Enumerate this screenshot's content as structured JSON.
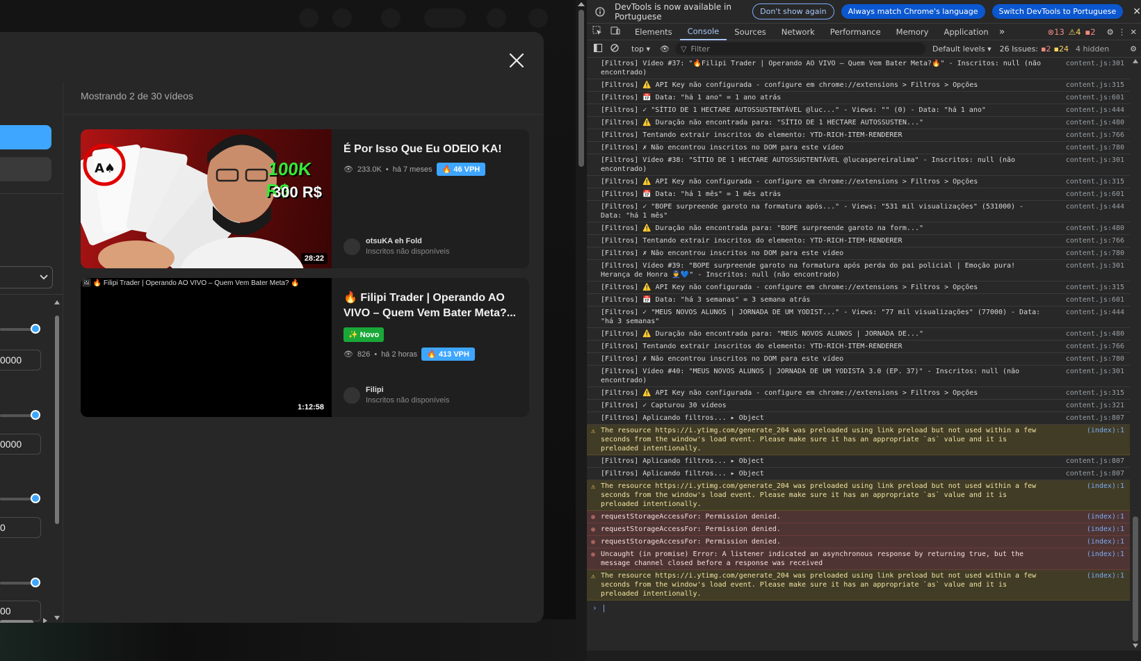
{
  "modal": {
    "showing": "Mostrando 2 de 30 vídeos",
    "inputs": [
      "0000",
      "0000",
      "0",
      "00"
    ],
    "videos": [
      {
        "title": "É Por Isso Que Eu ODEIO KA!",
        "views": "233.0K",
        "age": "há 7 meses",
        "vph": "46 VPH",
        "channel": "otsuKA eh Fold",
        "subs": "Inscritos não disponíveis",
        "duration": "28:22",
        "thumb_text_1": "100K R$",
        "thumb_text_2": "300 R$"
      },
      {
        "title": "🔥 Filipi Trader | Operando AO VIVO – Quem Vem Bater Meta?...",
        "thumb_alt": "🔥 Filipi Trader | Operando AO VIVO – Quem Vem Bater Meta? 🔥",
        "badge": "✨ Novo",
        "views": "826",
        "age": "há 2 horas",
        "vph": "413 VPH",
        "channel": "Filipi",
        "subs": "Inscritos não disponíveis",
        "duration": "1:12:58"
      }
    ]
  },
  "devtools": {
    "infobar": {
      "message": "DevTools is now available in Portuguese",
      "btn_dont_show": "Don't show again",
      "btn_always_match": "Always match Chrome's language",
      "btn_switch": "Switch DevTools to Portuguese"
    },
    "tabs": [
      "Elements",
      "Console",
      "Sources",
      "Network",
      "Performance",
      "Memory",
      "Application"
    ],
    "badges": {
      "errors": "13",
      "warnings": "4",
      "info": "2"
    },
    "toolbar": {
      "context": "top ▾",
      "filter_placeholder": "Filter",
      "levels": "Default levels ▾",
      "issues_label": "26 Issues:",
      "issues_err": "2",
      "issues_warn": "24",
      "hidden": "4 hidden"
    },
    "logs": [
      {
        "type": "log",
        "text": "[Filtros] Vídeo #37: \"🔥Filipi Trader | Operando AO VIVO – Quem Vem Bater Meta?🔥\" - Inscritos: null (não encontrado)",
        "src": "content.js:301"
      },
      {
        "type": "log",
        "text": "[Filtros] ⚠️ API Key não configurada - configure em chrome://extensions > Filtros > Opções",
        "src": "content.js:315"
      },
      {
        "type": "log",
        "text": "[Filtros] 📅 Data: \"há 1 ano\" = 1 ano atrás",
        "src": "content.js:601"
      },
      {
        "type": "log",
        "text": "[Filtros] ✓ \"SÍTIO DE 1 HECTARE AUTOSSUSTENTÁVEL @luc...\" - Views: \"\" (0) - Data: \"há 1 ano\"",
        "src": "content.js:444"
      },
      {
        "type": "log",
        "text": "[Filtros] ⚠️ Duração não encontrada para: \"SÍTIO DE 1 HECTARE AUTOSSUSTEN...\"",
        "src": "content.js:480"
      },
      {
        "type": "log",
        "text": "[Filtros] Tentando extrair inscritos do elemento: YTD-RICH-ITEM-RENDERER",
        "src": "content.js:766"
      },
      {
        "type": "log",
        "text": "[Filtros] ✗ Não encontrou inscritos no DOM para este vídeo",
        "src": "content.js:780"
      },
      {
        "type": "log",
        "text": "[Filtros] Vídeo #38: \"SÍTIO DE 1 HECTARE AUTOSSUSTENTÁVEL @lucaspereiralima\" - Inscritos: null (não encontrado)",
        "src": "content.js:301"
      },
      {
        "type": "log",
        "text": "[Filtros] ⚠️ API Key não configurada - configure em chrome://extensions > Filtros > Opções",
        "src": "content.js:315"
      },
      {
        "type": "log",
        "text": "[Filtros] 📅 Data: \"há 1 mês\" = 1 mês atrás",
        "src": "content.js:601"
      },
      {
        "type": "log",
        "text": "[Filtros] ✓ \"BOPE surpreende garoto na formatura após...\" - Views: \"531 mil visualizações\" (531000) - Data: \"há 1 mês\"",
        "src": "content.js:444"
      },
      {
        "type": "log",
        "text": "[Filtros] ⚠️ Duração não encontrada para: \"BOPE surpreende garoto na form...\"",
        "src": "content.js:480"
      },
      {
        "type": "log",
        "text": "[Filtros] Tentando extrair inscritos do elemento: YTD-RICH-ITEM-RENDERER",
        "src": "content.js:766"
      },
      {
        "type": "log",
        "text": "[Filtros] ✗ Não encontrou inscritos no DOM para este vídeo",
        "src": "content.js:780"
      },
      {
        "type": "log",
        "text": "[Filtros] Vídeo #39: \"BOPE surpreende garoto na formatura após perda do pai policial | Emoção pura! Herança de Honra 👮💙\" - Inscritos: null (não encontrado)",
        "src": "content.js:301"
      },
      {
        "type": "log",
        "text": "[Filtros] ⚠️ API Key não configurada - configure em chrome://extensions > Filtros > Opções",
        "src": "content.js:315"
      },
      {
        "type": "log",
        "text": "[Filtros] 📅 Data: \"há 3 semanas\" = 3 semana atrás",
        "src": "content.js:601"
      },
      {
        "type": "log",
        "text": "[Filtros] ✓ \"MEUS NOVOS ALUNOS | JORNADA DE UM YODIST...\" - Views: \"77 mil visualizações\" (77000) - Data: \"há 3 semanas\"",
        "src": "content.js:444"
      },
      {
        "type": "log",
        "text": "[Filtros] ⚠️ Duração não encontrada para: \"MEUS NOVOS ALUNOS | JORNADA DE...\"",
        "src": "content.js:480"
      },
      {
        "type": "log",
        "text": "[Filtros] Tentando extrair inscritos do elemento: YTD-RICH-ITEM-RENDERER",
        "src": "content.js:766"
      },
      {
        "type": "log",
        "text": "[Filtros] ✗ Não encontrou inscritos no DOM para este vídeo",
        "src": "content.js:780"
      },
      {
        "type": "log",
        "text": "[Filtros] Vídeo #40: \"MEUS NOVOS ALUNOS | JORNADA DE UM YODISTA 3.0 (EP. 37)\" - Inscritos: null (não encontrado)",
        "src": "content.js:301"
      },
      {
        "type": "log",
        "text": "[Filtros] ⚠️ API Key não configurada - configure em chrome://extensions > Filtros > Opções",
        "src": "content.js:315"
      },
      {
        "type": "log",
        "text": "[Filtros] ✓ Capturou 30 vídeos",
        "src": "content.js:321"
      },
      {
        "type": "log",
        "text": "[Filtros] Aplicando filtros... ▸ Object",
        "src": "content.js:807"
      },
      {
        "type": "warn",
        "text": "The resource https://i.ytimg.com/generate_204 was preloaded using link preload but not used within a few seconds from the window's load event. Please make sure it has an appropriate `as` value and it is preloaded intentionally.",
        "src": "(index):1"
      },
      {
        "type": "log",
        "text": "[Filtros] Aplicando filtros... ▸ Object",
        "src": "content.js:807"
      },
      {
        "type": "log",
        "text": "[Filtros] Aplicando filtros... ▸ Object",
        "src": "content.js:807"
      },
      {
        "type": "warn",
        "text": "The resource https://i.ytimg.com/generate_204 was preloaded using link preload but not used within a few seconds from the window's load event. Please make sure it has an appropriate `as` value and it is preloaded intentionally.",
        "src": "(index):1"
      },
      {
        "type": "err",
        "text": "requestStorageAccessFor: Permission denied.",
        "src": "(index):1"
      },
      {
        "type": "err",
        "text": "requestStorageAccessFor: Permission denied.",
        "src": "(index):1"
      },
      {
        "type": "err",
        "text": "requestStorageAccessFor: Permission denied.",
        "src": "(index):1"
      },
      {
        "type": "err",
        "text": "Uncaught (in promise) Error: A listener indicated an asynchronous response by returning true, but the message channel closed before a response was received",
        "src": "(index):1"
      },
      {
        "type": "warn",
        "text": "The resource https://i.ytimg.com/generate_204 was preloaded using link preload but not used within a few seconds from the window's load event. Please make sure it has an appropriate `as` value and it is preloaded intentionally.",
        "src": "(index):1"
      }
    ],
    "prompt": "›"
  }
}
